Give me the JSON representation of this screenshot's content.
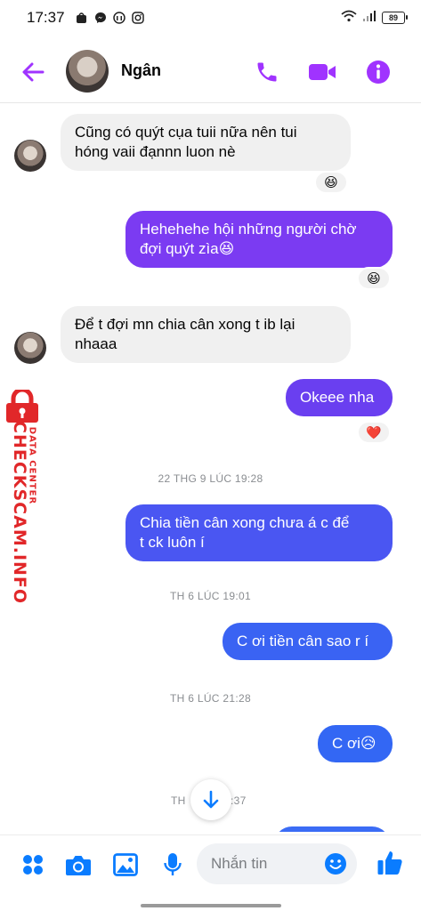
{
  "status_bar": {
    "time": "17:37",
    "battery": "89",
    "left_icons": [
      "shopee-icon",
      "messenger-icon",
      "podcast-icon",
      "instagram-icon"
    ]
  },
  "header": {
    "contact_name": "Ngân",
    "accent_color": "#a033ff"
  },
  "messages": [
    {
      "id": 1,
      "dir": "in",
      "text": "Cũng có quýt cụa tuii nữa nên tui\nhóng vaii đạnnn luon nè",
      "reaction": "😆"
    },
    {
      "id": 2,
      "dir": "out",
      "text": "Hehehehe hội những người chờ\nđợi quýt zìa😆",
      "reaction": "😆",
      "color": "#7b3bf2"
    },
    {
      "id": 3,
      "dir": "in",
      "text": "Để t đợi mn chia cân xong t ib lại\nnhaaa",
      "reaction": ""
    },
    {
      "id": 4,
      "dir": "out",
      "text": "Okeee nha",
      "reaction": "❤️",
      "color": "#6a3ff0"
    },
    {
      "id": 5,
      "dir": "out",
      "text": "Chia tiền cân xong chưa á c để\nt ck luôn í",
      "reaction": "",
      "color": "#4a56f2"
    },
    {
      "id": 6,
      "dir": "out",
      "text": "C ơi tiền cân sao r í",
      "reaction": "",
      "color": "#3a63f3"
    },
    {
      "id": 7,
      "dir": "out",
      "text": "C ơi😥",
      "reaction": "",
      "color": "#3367f4"
    }
  ],
  "timestamps": [
    "22 THG 9 LÚC 19:28",
    "TH 6 LÚC 19:01",
    "TH 6 LÚC 21:28",
    "TH",
    ":37"
  ],
  "watermark": {
    "main": "CHECKSCAM.INFO",
    "sub": "DATA CENTER"
  },
  "composer": {
    "placeholder": "Nhắn tin",
    "accent_color": "#0a7cff"
  }
}
